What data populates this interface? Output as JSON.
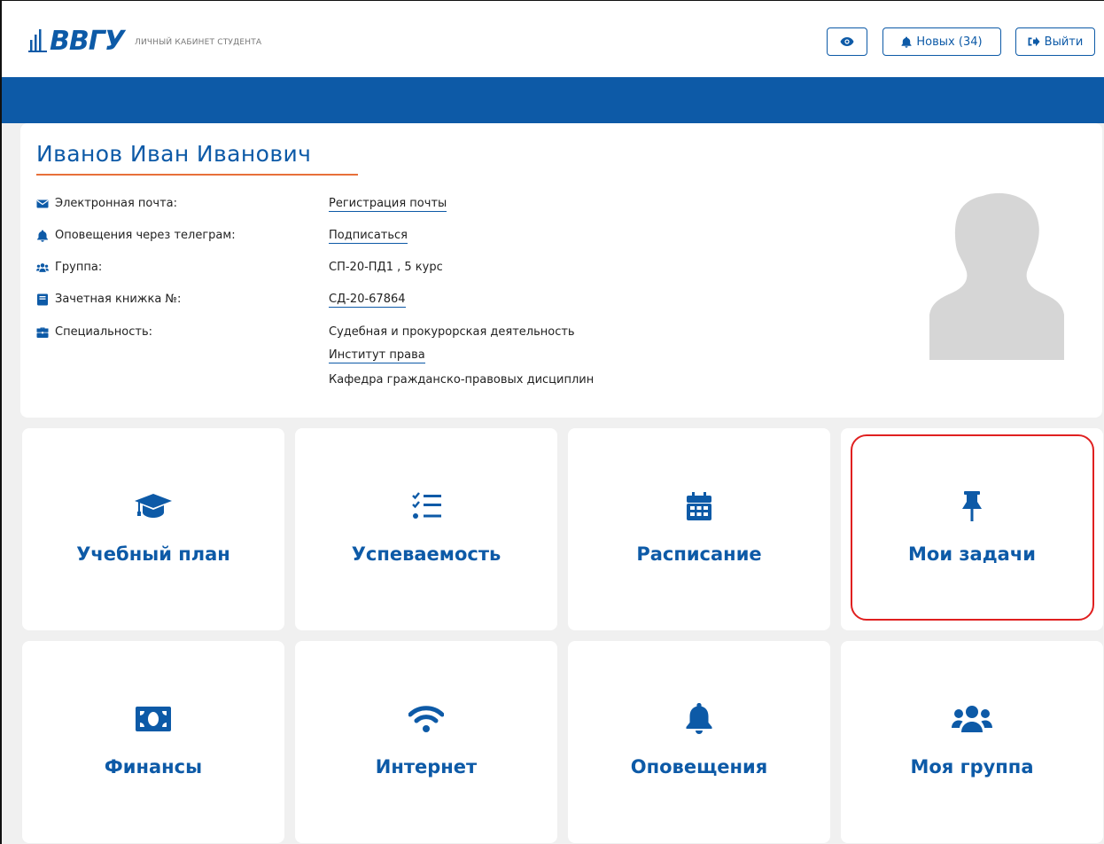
{
  "header": {
    "logo_text": "ВВГУ",
    "subtitle": "ЛИЧНЫЙ КАБИНЕТ СТУДЕНТА",
    "news_label": "Новых (34)",
    "exit_label": "Выйти"
  },
  "profile": {
    "name": "Иванов Иван Иванович",
    "rows": [
      {
        "label": "Электронная почта:",
        "icon": "envelope-icon",
        "value": "Регистрация почты"
      },
      {
        "label": "Оповещения через телеграм:",
        "icon": "bell-icon",
        "value": "Подписаться"
      },
      {
        "label": "Группа:",
        "icon": "users-icon",
        "value": "СП-20-ПД1 , 5 курс"
      },
      {
        "label": "Зачетная книжка №:",
        "icon": "book-icon",
        "value": "СД-20-67864"
      },
      {
        "label": "Специальность:",
        "icon": "briefcase-icon",
        "value": "Судебная и прокурорская деятельность"
      }
    ],
    "institute": "Институт права",
    "department": "Кафедра гражданско-правовых дисциплин"
  },
  "tiles": [
    {
      "label": "Учебный план",
      "icon": "graduation-cap-icon"
    },
    {
      "label": "Успеваемость",
      "icon": "checklist-icon"
    },
    {
      "label": "Расписание",
      "icon": "calendar-icon"
    },
    {
      "label": "Мои задачи",
      "icon": "thumbtack-icon"
    },
    {
      "label": "Финансы",
      "icon": "money-icon"
    },
    {
      "label": "Интернет",
      "icon": "wifi-icon"
    },
    {
      "label": "Оповещения",
      "icon": "bell-icon"
    },
    {
      "label": "Моя группа",
      "icon": "users-icon"
    }
  ],
  "colors": {
    "brand": "#0d5aa7",
    "accent": "#e8703a",
    "highlight": "#e02020"
  }
}
